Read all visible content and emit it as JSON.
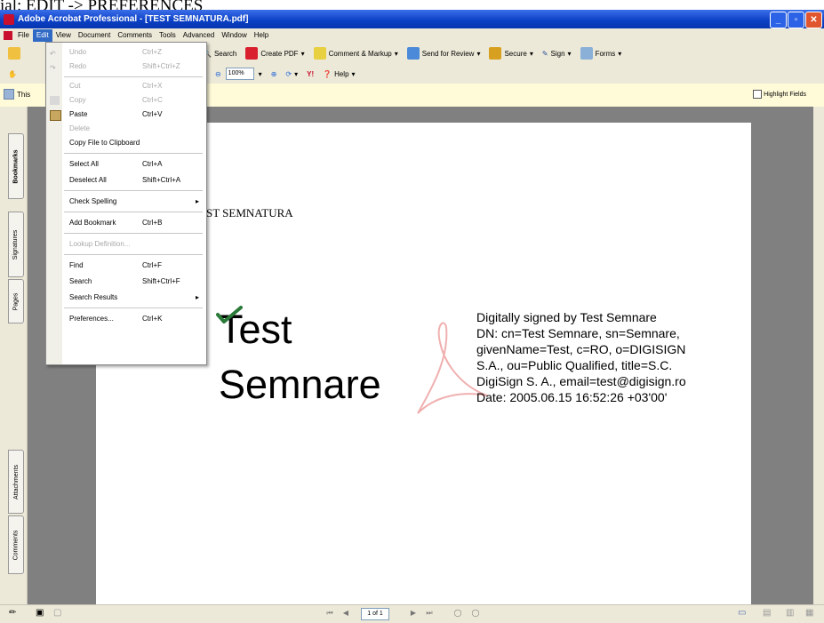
{
  "caption": "ial: EDIT -> PREFERENCES",
  "window": {
    "title": "Adobe Acrobat Professional - [TEST SEMNATURA.pdf]"
  },
  "menubar": [
    "File",
    "Edit",
    "View",
    "Document",
    "Comments",
    "Tools",
    "Advanced",
    "Window",
    "Help"
  ],
  "toolbar1": {
    "search": "Search",
    "create_pdf": "Create PDF",
    "comment_markup": "Comment & Markup",
    "send_review": "Send for Review",
    "secure": "Secure",
    "sign": "Sign",
    "forms": "Forms"
  },
  "toolbar2": {
    "zoom": "100%",
    "help": "Help"
  },
  "messagebar": {
    "thumb_label": "This",
    "highlight_fields": "Highlight Fields"
  },
  "side_tabs": [
    "Bookmarks",
    "Signatures",
    "Pages",
    "Attachments",
    "Comments"
  ],
  "edit_menu": [
    {
      "label": "Undo",
      "shortcut": "Ctrl+Z",
      "disabled": true
    },
    {
      "label": "Redo",
      "shortcut": "Shift+Ctrl+Z",
      "disabled": true
    },
    {
      "label": "Cut",
      "shortcut": "Ctrl+X",
      "disabled": true
    },
    {
      "label": "Copy",
      "shortcut": "Ctrl+C",
      "disabled": true
    },
    {
      "label": "Paste",
      "shortcut": "Ctrl+V",
      "disabled": false
    },
    {
      "label": "Delete",
      "shortcut": "",
      "disabled": true
    },
    {
      "label": "Copy File to Clipboard",
      "shortcut": "",
      "disabled": false
    },
    {
      "label": "Select All",
      "shortcut": "Ctrl+A",
      "disabled": false
    },
    {
      "label": "Deselect All",
      "shortcut": "Shift+Ctrl+A",
      "disabled": false
    },
    {
      "label": "Check Spelling",
      "shortcut": "",
      "disabled": false,
      "submenu": true
    },
    {
      "label": "Add Bookmark",
      "shortcut": "Ctrl+B",
      "disabled": false
    },
    {
      "label": "Lookup Definition...",
      "shortcut": "",
      "disabled": true
    },
    {
      "label": "Find",
      "shortcut": "Ctrl+F",
      "disabled": false
    },
    {
      "label": "Search",
      "shortcut": "Shift+Ctrl+F",
      "disabled": false
    },
    {
      "label": "Search Results",
      "shortcut": "",
      "disabled": false,
      "submenu": true
    },
    {
      "label": "Preferences...",
      "shortcut": "Ctrl+K",
      "disabled": false
    }
  ],
  "document": {
    "heading": "ST SEMNATURA",
    "signer_first": "Test",
    "signer_last": "Semnare",
    "signature_lines": [
      "Digitally signed by Test Semnare",
      "DN: cn=Test Semnare, sn=Semnare,",
      "givenName=Test, c=RO, o=DIGISIGN",
      "S.A., ou=Public Qualified, title=S.C.",
      "DigiSign S. A., email=test@digisign.ro",
      "Date: 2005.06.15 16:52:26 +03'00'"
    ]
  },
  "statusbar": {
    "page": "1 of 1"
  },
  "colors": {
    "titlebar": "#0a3fc4",
    "menu_highlight": "#316ac5",
    "chrome": "#ece9d8",
    "workspace": "#808080"
  }
}
